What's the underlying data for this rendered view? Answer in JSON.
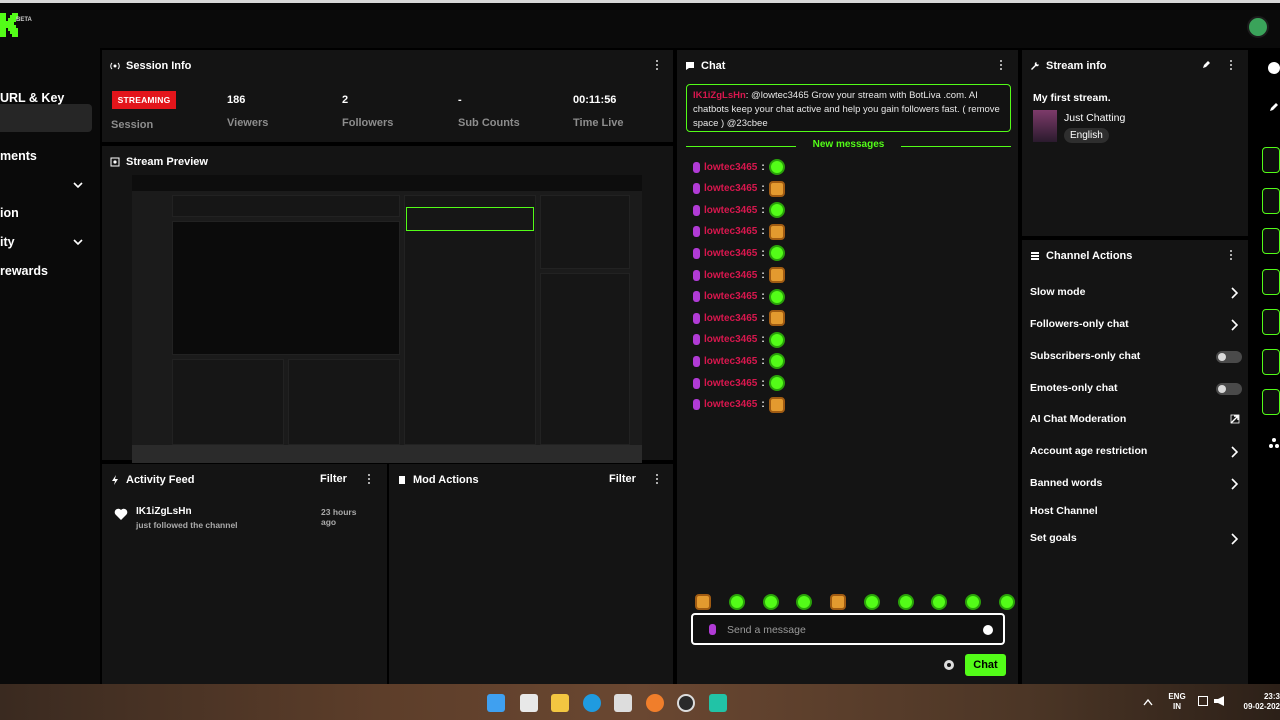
{
  "logo_beta": "BETA",
  "sidebar": {
    "items": [
      {
        "label": "URL & Key"
      },
      {
        "label": "ments"
      },
      {
        "label": "ion"
      },
      {
        "label": "ity"
      },
      {
        "label": "rewards"
      }
    ]
  },
  "session": {
    "title": "Session Info",
    "badge": "STREAMING",
    "session_label": "Session",
    "stats": [
      {
        "value": "186",
        "label": "Viewers"
      },
      {
        "value": "2",
        "label": "Followers"
      },
      {
        "value": "-",
        "label": "Sub Counts"
      },
      {
        "value": "00:11:56",
        "label": "Time Live"
      }
    ]
  },
  "preview": {
    "title": "Stream Preview"
  },
  "activity": {
    "title": "Activity Feed",
    "filter": "Filter",
    "items": [
      {
        "user": "IK1iZgLsHn",
        "action": "just followed the channel",
        "time": "23 hours ago"
      }
    ]
  },
  "mod": {
    "title": "Mod Actions",
    "filter": "Filter"
  },
  "chat": {
    "title": "Chat",
    "pinned_user": "IK1iZgLsHn",
    "pinned_text": ": @lowtec3465 Grow your stream with BotLiva .com. AI chatbots keep your chat active and help you gain followers fast. ( remove space ) @23cbee",
    "new_messages": "New messages",
    "messages": [
      {
        "user": "lowtec3465",
        "emote": "green"
      },
      {
        "user": "lowtec3465",
        "emote": "orange"
      },
      {
        "user": "lowtec3465",
        "emote": "green"
      },
      {
        "user": "lowtec3465",
        "emote": "orange"
      },
      {
        "user": "lowtec3465",
        "emote": "green"
      },
      {
        "user": "lowtec3465",
        "emote": "orange"
      },
      {
        "user": "lowtec3465",
        "emote": "green"
      },
      {
        "user": "lowtec3465",
        "emote": "orange"
      },
      {
        "user": "lowtec3465",
        "emote": "green"
      },
      {
        "user": "lowtec3465",
        "emote": "green"
      },
      {
        "user": "lowtec3465",
        "emote": "green"
      },
      {
        "user": "lowtec3465",
        "emote": "orange"
      }
    ],
    "placeholder": "Send a message",
    "send_label": "Chat"
  },
  "stream_info": {
    "title": "Stream info",
    "stream_title": "My first stream.",
    "category": "Just Chatting",
    "language": "English"
  },
  "channel_actions": {
    "title": "Channel Actions",
    "items": [
      {
        "label": "Slow mode",
        "control": "chevron"
      },
      {
        "label": "Followers-only chat",
        "control": "chevron"
      },
      {
        "label": "Subscribers-only chat",
        "control": "toggle"
      },
      {
        "label": "Emotes-only chat",
        "control": "toggle"
      },
      {
        "label": "AI Chat Moderation",
        "control": "external"
      },
      {
        "label": "Account age restriction",
        "control": "chevron"
      },
      {
        "label": "Banned words",
        "control": "chevron"
      },
      {
        "label": "Host Channel",
        "control": "none"
      },
      {
        "label": "Set goals",
        "control": "chevron"
      }
    ]
  },
  "taskbar": {
    "lang_top": "ENG",
    "lang_bottom": "IN",
    "time": "23:3",
    "date": "09-02-202"
  },
  "colors": {
    "accent": "#53fc18",
    "live": "#e3151b",
    "username": "#d8174e"
  }
}
